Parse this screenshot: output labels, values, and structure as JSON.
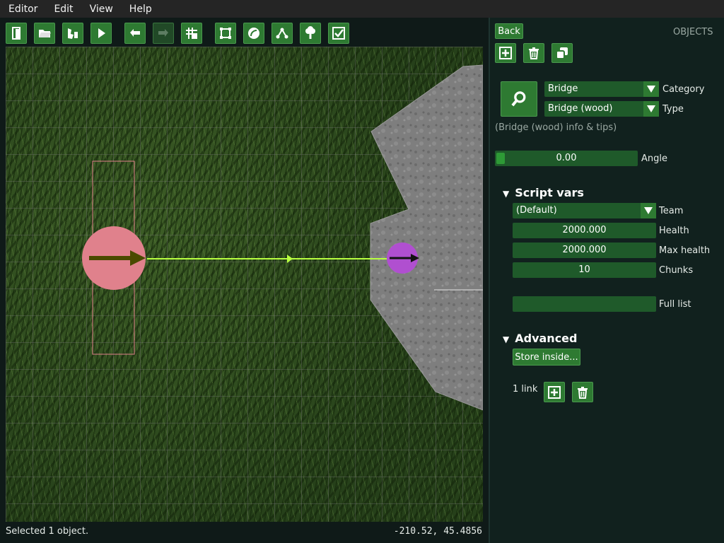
{
  "menubar": {
    "items": [
      "Editor",
      "Edit",
      "View",
      "Help"
    ]
  },
  "toolbar": {
    "buttons": [
      {
        "icon": "exit-door-icon"
      },
      {
        "icon": "open-folder-icon"
      },
      {
        "icon": "save-icon"
      },
      {
        "icon": "play-icon"
      },
      {
        "icon": "undo-icon"
      },
      {
        "icon": "redo-icon"
      },
      {
        "icon": "grid-snap-icon"
      },
      {
        "icon": "transform-icon"
      },
      {
        "icon": "rotate-icon"
      },
      {
        "icon": "path-nodes-icon"
      },
      {
        "icon": "tree-icon"
      },
      {
        "icon": "checkbox-icon"
      }
    ]
  },
  "status": {
    "message": "Selected 1 object.",
    "coords": "-210.52, 45.4856"
  },
  "panel": {
    "back_label": "Back",
    "section_title": "OBJECTS",
    "category": {
      "value": "Bridge",
      "label": "Category"
    },
    "type": {
      "value": "Bridge (wood)",
      "label": "Type"
    },
    "info_text": "(Bridge (wood) info & tips)",
    "angle": {
      "value": "0.00",
      "label": "Angle",
      "fraction": 0.0
    },
    "script_vars": {
      "title": "Script vars",
      "team": {
        "value": "(Default)",
        "label": "Team"
      },
      "health": {
        "value": "2000.000",
        "label": "Health"
      },
      "max_health": {
        "value": "2000.000",
        "label": "Max health"
      },
      "chunks": {
        "value": "10",
        "label": "Chunks"
      },
      "full_list": {
        "value": "",
        "label": "Full list"
      }
    },
    "advanced": {
      "title": "Advanced",
      "store_inside_label": "Store inside...",
      "links_label": "1 link"
    }
  },
  "colors": {
    "button_green": "#2e7a32",
    "field_green": "#1f5a2a",
    "panel_bg": "#11211e",
    "selection_pink": "#e0818c",
    "link_line": "#b8ff40",
    "linked_object": "#b04fd0"
  }
}
